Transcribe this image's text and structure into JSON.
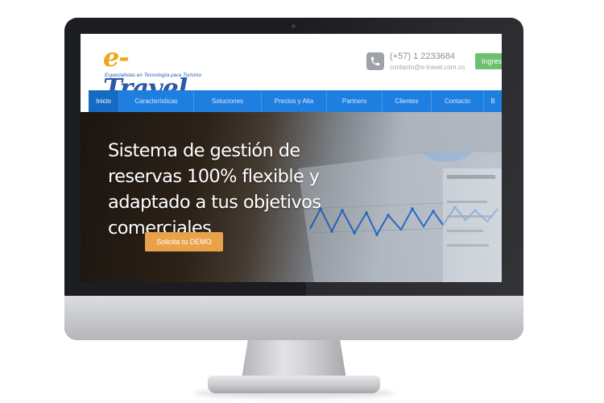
{
  "header": {
    "logo": {
      "part1": "e-",
      "part2": "Travel",
      "tagline": "Especialistas en Tecnología para Turismo"
    },
    "phone": "(+57) 1 2233684",
    "email": "contacto@e-travel.com.co",
    "login_label": "Ingresar"
  },
  "nav": {
    "items": [
      "Inicio",
      "Características",
      "Soluciones",
      "Precios y Alta",
      "Partners",
      "Clientes",
      "Contacto",
      "B"
    ],
    "active": "Inicio"
  },
  "hero": {
    "title": "Sistema de gestión de reservas 100% flexible y adaptado a tus objetivos comerciales",
    "cta_label": "Solicita tu DEMO"
  },
  "colors": {
    "nav_blue": "#1f7fe0",
    "cta_orange": "#e9a24a",
    "login_green": "#6cc070",
    "logo_orange": "#f2a51a",
    "logo_blue": "#2a5aa8"
  }
}
